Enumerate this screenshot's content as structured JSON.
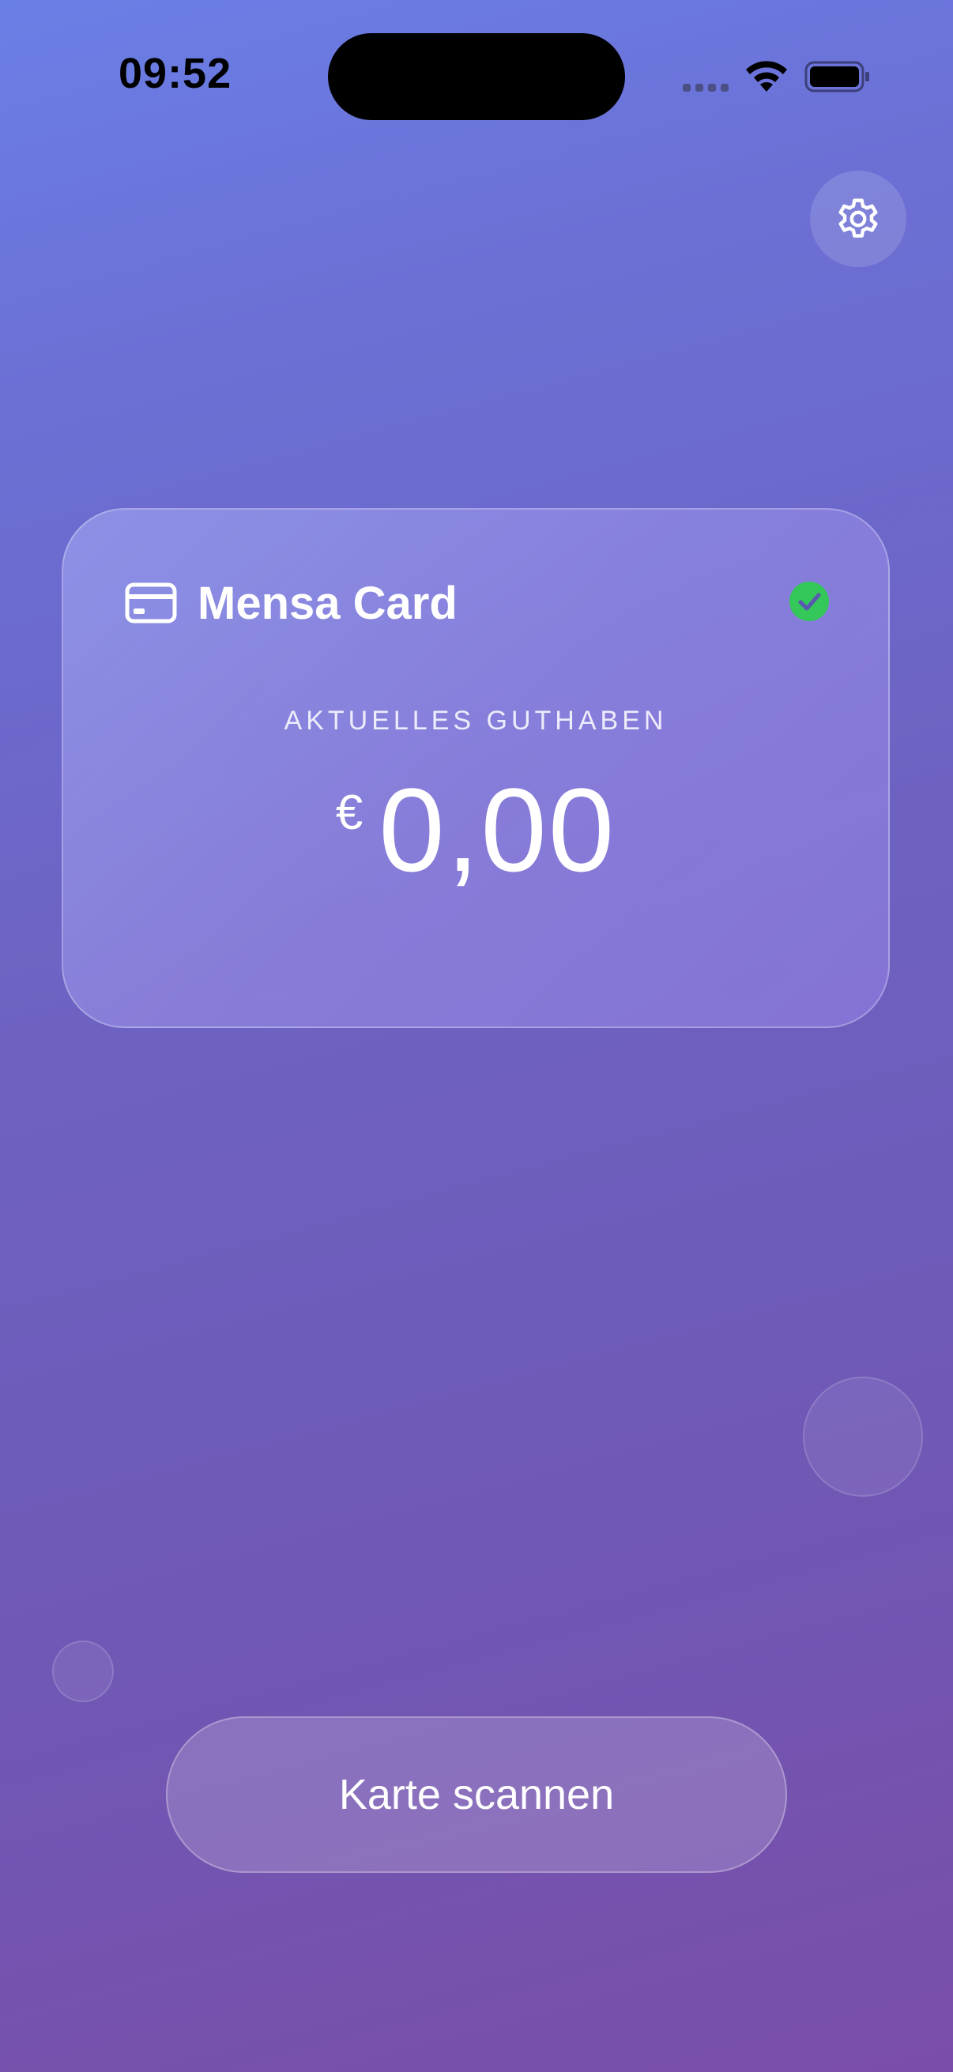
{
  "status_bar": {
    "time": "09:52"
  },
  "header": {
    "settings_icon": "gear-icon"
  },
  "card": {
    "icon": "credit-card-icon",
    "title": "Mensa Card",
    "verified_icon": "checkmark-circle-icon",
    "verified_color": "#34c759",
    "balance_label": "AKTUELLES GUTHABEN",
    "currency": "€",
    "balance": "0,00"
  },
  "actions": {
    "scan_label": "Karte scannen"
  },
  "colors": {
    "background_top": "#6a7fe6",
    "background_bottom": "#7a4ea8"
  }
}
